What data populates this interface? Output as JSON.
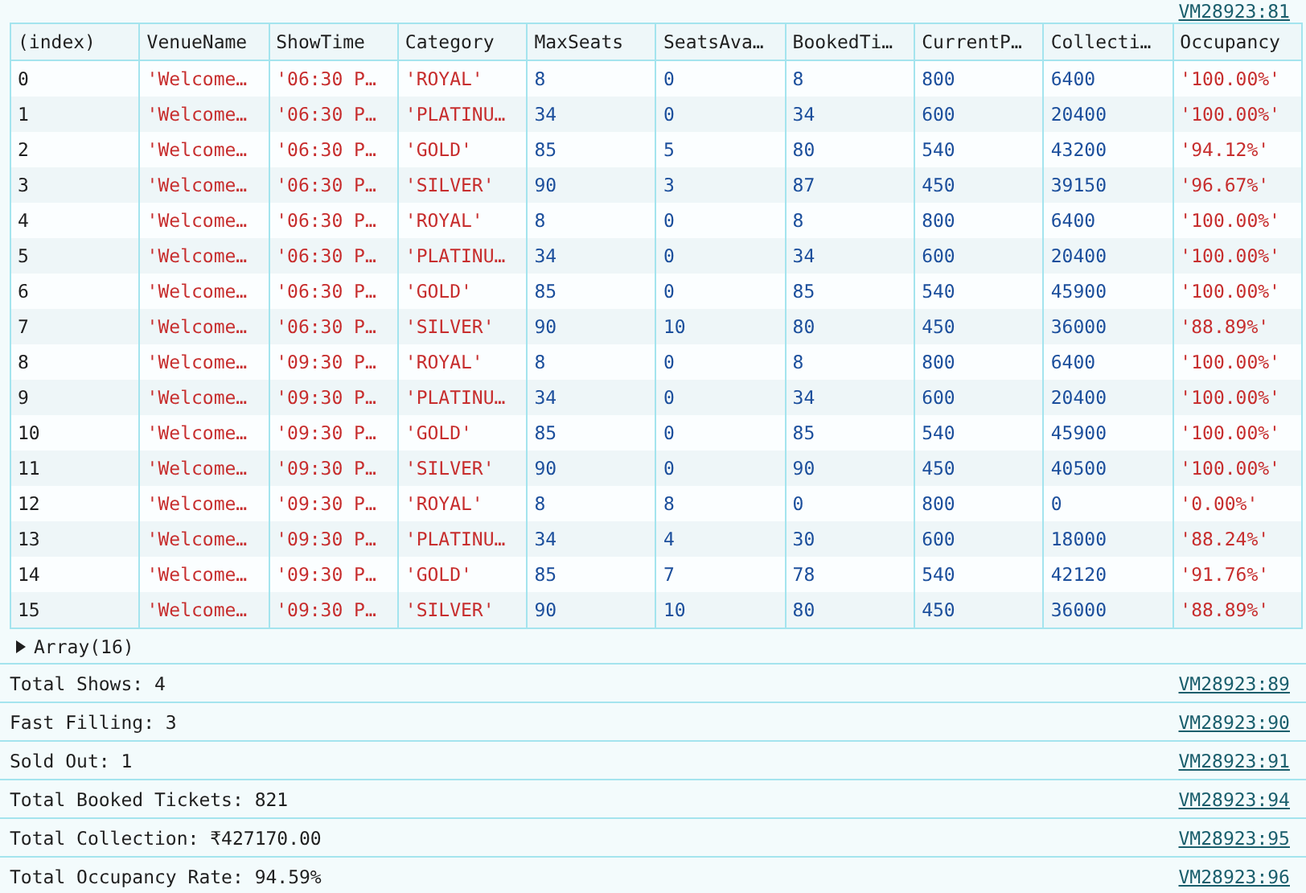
{
  "table_source": "VM28923:81",
  "table": {
    "columns": [
      {
        "label": "(index)",
        "kind": "index"
      },
      {
        "label": "VenueName",
        "kind": "string"
      },
      {
        "label": "ShowTime",
        "kind": "string"
      },
      {
        "label": "Category",
        "kind": "string"
      },
      {
        "label": "MaxSeats",
        "kind": "number"
      },
      {
        "label": "SeatsAva…",
        "kind": "number"
      },
      {
        "label": "BookedTi…",
        "kind": "number"
      },
      {
        "label": "CurrentP…",
        "kind": "number"
      },
      {
        "label": "Collecti…",
        "kind": "number"
      },
      {
        "label": "Occupancy",
        "kind": "string"
      }
    ],
    "rows": [
      [
        "0",
        "'Welcome…",
        "'06:30 P…",
        "'ROYAL'",
        "8",
        "0",
        "8",
        "800",
        "6400",
        "'100.00%'"
      ],
      [
        "1",
        "'Welcome…",
        "'06:30 P…",
        "'PLATINU…",
        "34",
        "0",
        "34",
        "600",
        "20400",
        "'100.00%'"
      ],
      [
        "2",
        "'Welcome…",
        "'06:30 P…",
        "'GOLD'",
        "85",
        "5",
        "80",
        "540",
        "43200",
        "'94.12%'"
      ],
      [
        "3",
        "'Welcome…",
        "'06:30 P…",
        "'SILVER'",
        "90",
        "3",
        "87",
        "450",
        "39150",
        "'96.67%'"
      ],
      [
        "4",
        "'Welcome…",
        "'06:30 P…",
        "'ROYAL'",
        "8",
        "0",
        "8",
        "800",
        "6400",
        "'100.00%'"
      ],
      [
        "5",
        "'Welcome…",
        "'06:30 P…",
        "'PLATINU…",
        "34",
        "0",
        "34",
        "600",
        "20400",
        "'100.00%'"
      ],
      [
        "6",
        "'Welcome…",
        "'06:30 P…",
        "'GOLD'",
        "85",
        "0",
        "85",
        "540",
        "45900",
        "'100.00%'"
      ],
      [
        "7",
        "'Welcome…",
        "'06:30 P…",
        "'SILVER'",
        "90",
        "10",
        "80",
        "450",
        "36000",
        "'88.89%'"
      ],
      [
        "8",
        "'Welcome…",
        "'09:30 P…",
        "'ROYAL'",
        "8",
        "0",
        "8",
        "800",
        "6400",
        "'100.00%'"
      ],
      [
        "9",
        "'Welcome…",
        "'09:30 P…",
        "'PLATINU…",
        "34",
        "0",
        "34",
        "600",
        "20400",
        "'100.00%'"
      ],
      [
        "10",
        "'Welcome…",
        "'09:30 P…",
        "'GOLD'",
        "85",
        "0",
        "85",
        "540",
        "45900",
        "'100.00%'"
      ],
      [
        "11",
        "'Welcome…",
        "'09:30 P…",
        "'SILVER'",
        "90",
        "0",
        "90",
        "450",
        "40500",
        "'100.00%'"
      ],
      [
        "12",
        "'Welcome…",
        "'09:30 P…",
        "'ROYAL'",
        "8",
        "8",
        "0",
        "800",
        "0",
        "'0.00%'"
      ],
      [
        "13",
        "'Welcome…",
        "'09:30 P…",
        "'PLATINU…",
        "34",
        "4",
        "30",
        "600",
        "18000",
        "'88.24%'"
      ],
      [
        "14",
        "'Welcome…",
        "'09:30 P…",
        "'GOLD'",
        "85",
        "7",
        "78",
        "540",
        "42120",
        "'91.76%'"
      ],
      [
        "15",
        "'Welcome…",
        "'09:30 P…",
        "'SILVER'",
        "90",
        "10",
        "80",
        "450",
        "36000",
        "'88.89%'"
      ]
    ]
  },
  "array_toggle": {
    "label": "Array(16)",
    "expanded": false
  },
  "logs": [
    {
      "text": "Total Shows: 4",
      "source": "VM28923:89"
    },
    {
      "text": "Fast Filling: 3",
      "source": "VM28923:90"
    },
    {
      "text": "Sold Out: 1",
      "source": "VM28923:91"
    },
    {
      "text": "Total Booked Tickets: 821",
      "source": "VM28923:94"
    },
    {
      "text": "Total Collection: ₹427170.00",
      "source": "VM28923:95"
    },
    {
      "text": "Total Occupancy Rate: 94.59%",
      "source": "VM28923:96"
    }
  ]
}
